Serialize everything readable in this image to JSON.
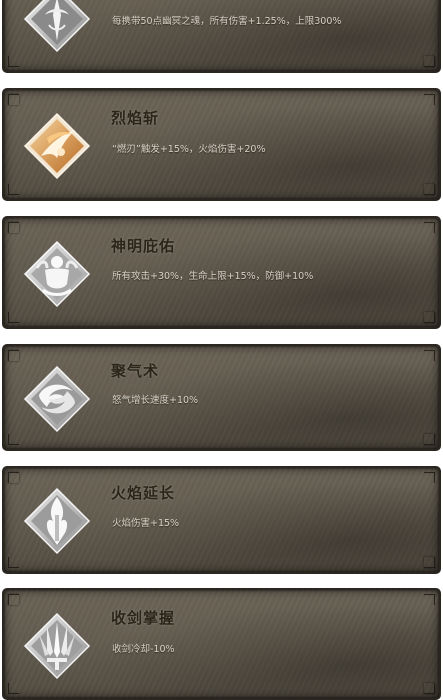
{
  "skills": [
    {
      "icon": "ghost-sword-icon",
      "title": "",
      "desc": "每携带50点幽冥之魂，所有伤害+1.25%，上限300%"
    },
    {
      "icon": "flame-blade-icon",
      "title": "烈焰斩",
      "desc": "“燃刃”触发+15%，火焰伤害+20%"
    },
    {
      "icon": "meditating-figure-icon",
      "title": "神明庇佑",
      "desc": "所有攻击+30%，生命上限+15%，防御+10%"
    },
    {
      "icon": "swirl-icon",
      "title": "聚气术",
      "desc": "怒气增长速度+10%"
    },
    {
      "icon": "flame-sword-icon",
      "title": "火焰延长",
      "desc": "火焰伤害+15%"
    },
    {
      "icon": "multi-sword-icon",
      "title": "收剑掌握",
      "desc": "收剑冷却-10%"
    }
  ],
  "colors": {
    "card_bg": "#5d574b",
    "title": "#2a2419",
    "desc": "#d9d3c6",
    "icon_silver": "#d8d8d8",
    "icon_gold": "#e0a04c"
  }
}
